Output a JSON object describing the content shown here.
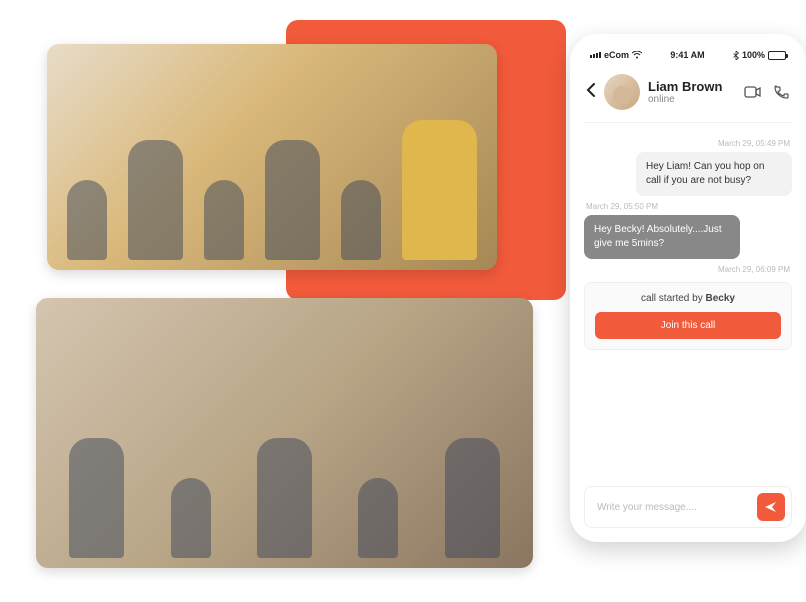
{
  "statusBar": {
    "carrier": "eCom",
    "time": "9:41 AM",
    "battery": "100%"
  },
  "header": {
    "name": "Liam Brown",
    "status": "online"
  },
  "messages": {
    "ts1": "March 29, 05:49 PM",
    "msg1": "Hey Liam! Can you hop on call if you are not busy?",
    "ts2": "March 29, 05:50 PM",
    "msg2": "Hey Becky! Absolutely....Just give me 5mins?",
    "ts3": "March 29, 06:09 PM",
    "callText": "call started by ",
    "callBy": "Becky",
    "joinLabel": "Join this call"
  },
  "composer": {
    "placeholder": "Write your message...."
  }
}
